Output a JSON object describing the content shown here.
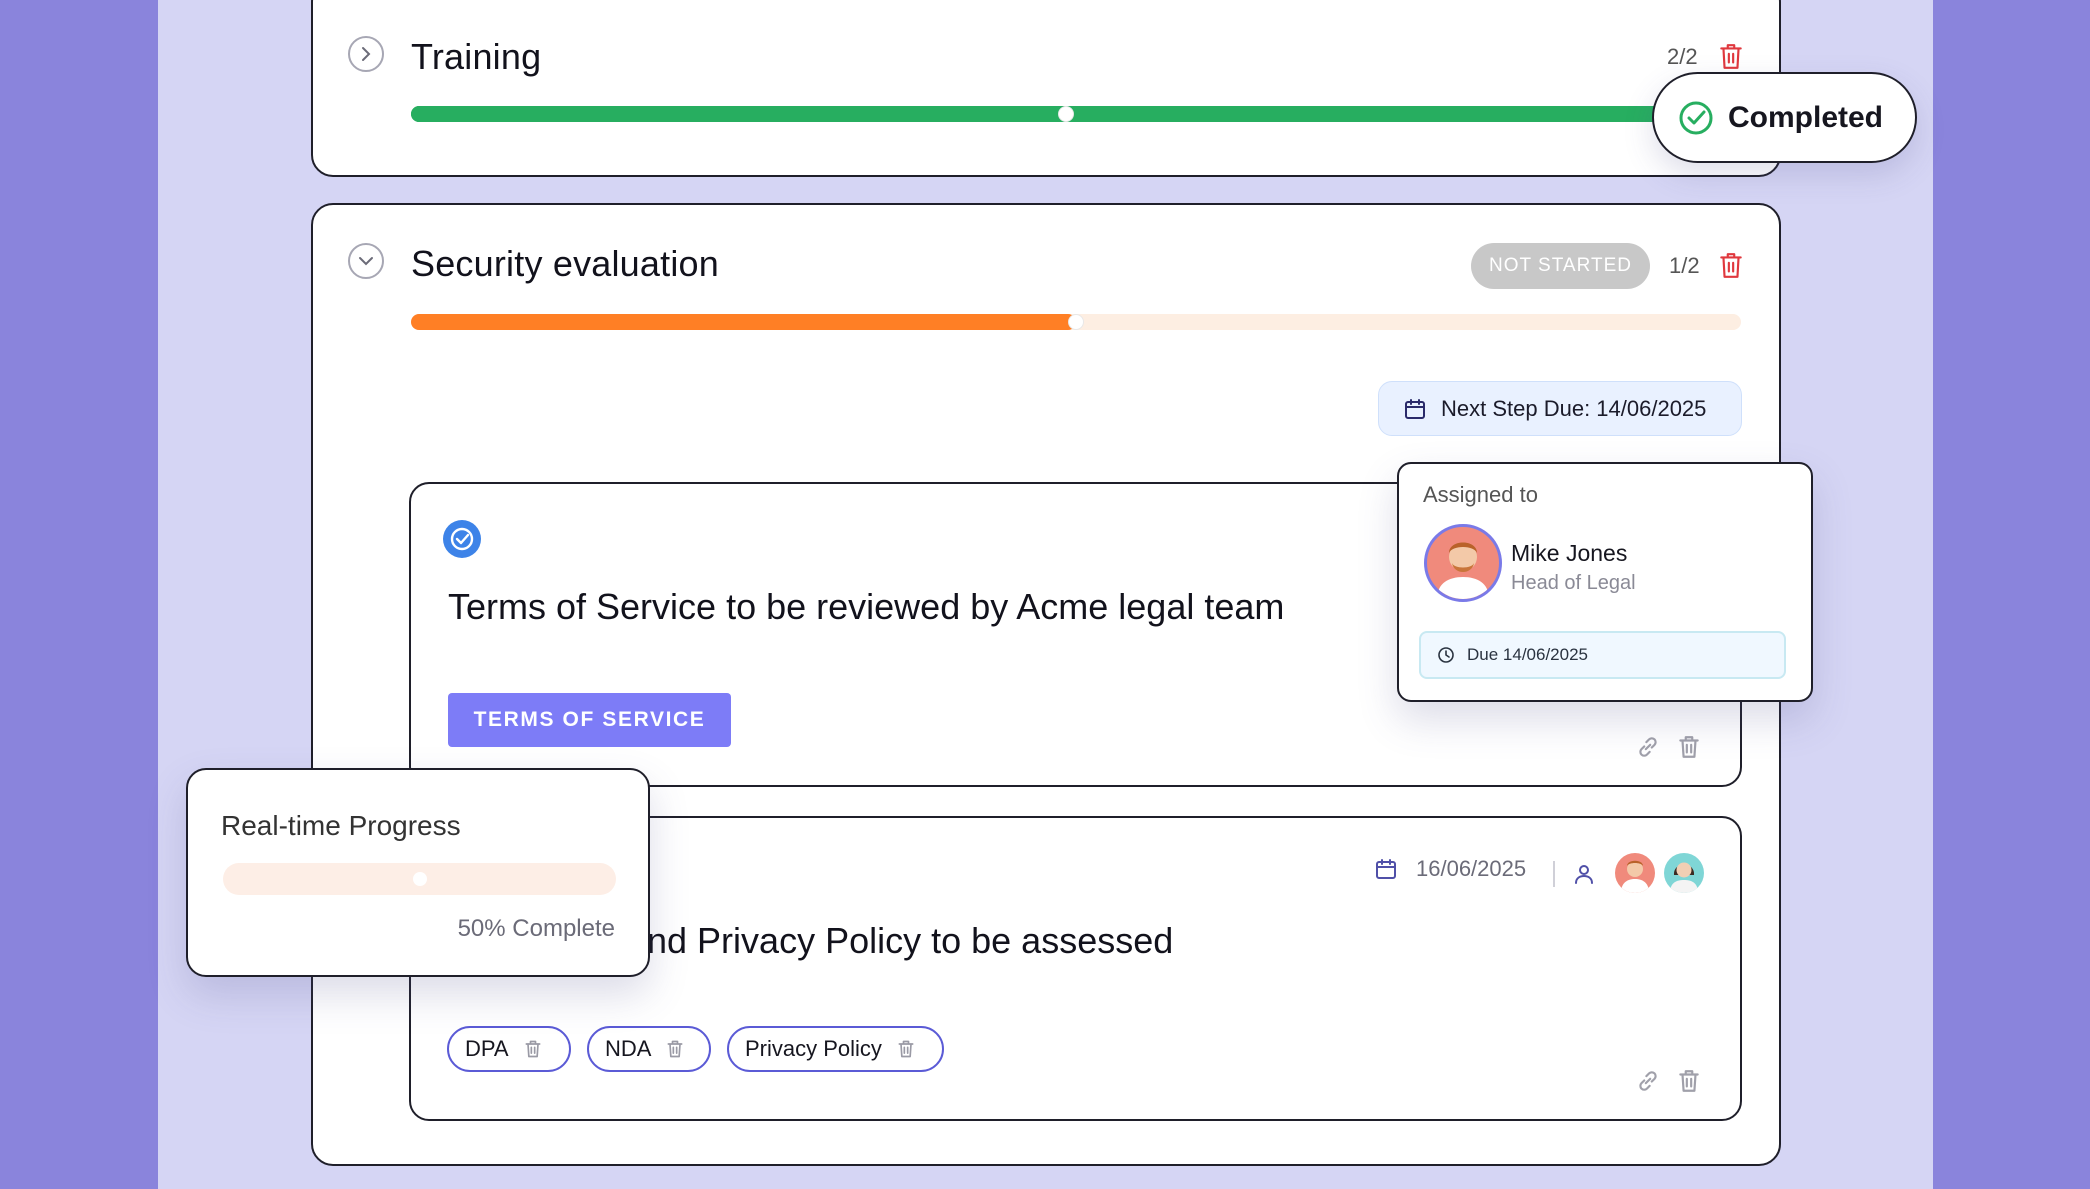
{
  "training": {
    "title": "Training",
    "count": "2/2",
    "progress": 1.0,
    "progress_color": "#27ae60",
    "status": "Completed"
  },
  "security": {
    "title": "Security evaluation",
    "status": "NOT STARTED",
    "count": "1/2",
    "progress": 0.5,
    "progress_color": "#ff7f25",
    "track_color": "#fdeee2",
    "next_step_due": "Next Step Due: 14/06/2025"
  },
  "tasks": [
    {
      "title": "Terms of Service to be reviewed by Acme legal team",
      "button_label": "TERMS OF SERVICE"
    },
    {
      "title_visible": "nd Privacy Policy to be assessed",
      "date": "16/06/2025",
      "tags": [
        "DPA",
        "NDA",
        "Privacy Policy"
      ]
    }
  ],
  "assigned": {
    "label": "Assigned to",
    "name": "Mike Jones",
    "role": "Head of Legal",
    "due": "Due 14/06/2025"
  },
  "realtime": {
    "title": "Real-time Progress",
    "progress": 0.5,
    "text": "50% Complete"
  },
  "colors": {
    "accent": "#7d7cf7",
    "danger": "#e0383e",
    "check_blue": "#3d83e8",
    "completed_green": "#27ae60"
  }
}
